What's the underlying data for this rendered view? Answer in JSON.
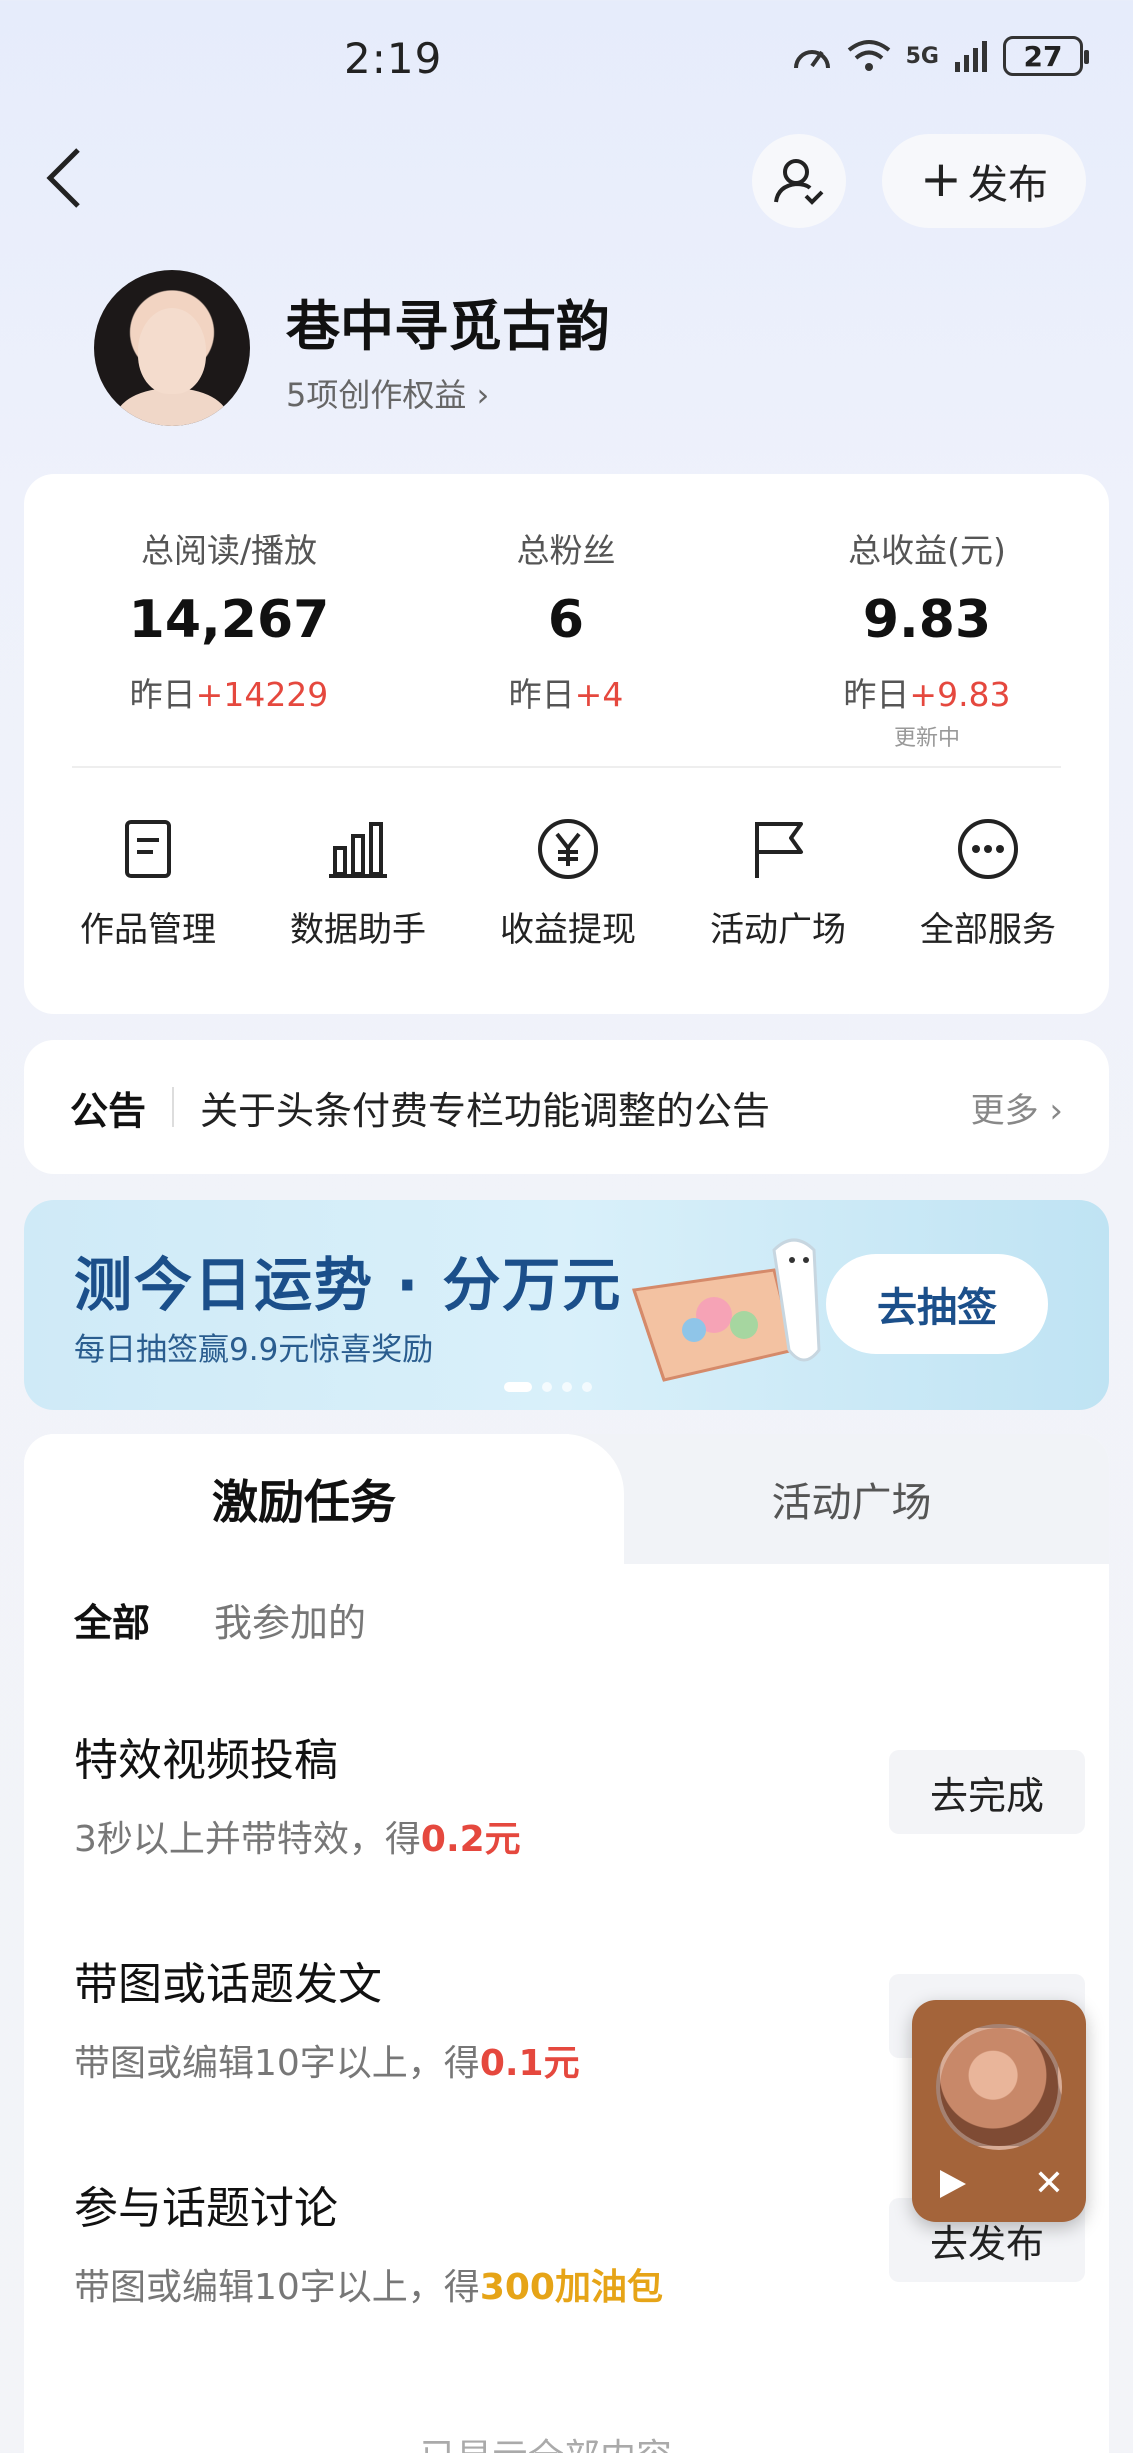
{
  "status_bar": {
    "time": "2:19",
    "network": "5G",
    "battery": "27"
  },
  "header": {
    "publish_label": "发布"
  },
  "profile": {
    "name": "巷中寻觅古韵",
    "rights_link": "5项创作权益 ›"
  },
  "stats": [
    {
      "label": "总阅读/播放",
      "value": "14,267",
      "delta_prefix": "昨日",
      "delta": "+14229",
      "note": ""
    },
    {
      "label": "总粉丝",
      "value": "6",
      "delta_prefix": "昨日",
      "delta": "+4",
      "note": ""
    },
    {
      "label": "总收益(元)",
      "value": "9.83",
      "delta_prefix": "昨日",
      "delta": "+9.83",
      "note": "更新中"
    }
  ],
  "services": [
    {
      "label": "作品管理",
      "icon": "document-icon"
    },
    {
      "label": "数据助手",
      "icon": "bar-chart-icon"
    },
    {
      "label": "收益提现",
      "icon": "yuan-icon"
    },
    {
      "label": "活动广场",
      "icon": "flag-icon"
    },
    {
      "label": "全部服务",
      "icon": "more-icon"
    }
  ],
  "notice": {
    "tag": "公告",
    "text": "关于头条付费专栏功能调整的公告",
    "more": "更多 ›"
  },
  "banner": {
    "title": "测今日运势 · 分万元",
    "subtitle": "每日抽签赢9.9元惊喜奖励",
    "button": "去抽签"
  },
  "tasks": {
    "tabs": [
      "激励任务",
      "活动广场"
    ],
    "filters": [
      "全部",
      "我参加的"
    ],
    "items": [
      {
        "title": "特效视频投稿",
        "desc": "3秒以上并带特效，得",
        "reward": "0.2元",
        "button": "去完成"
      },
      {
        "title": "带图或话题发文",
        "desc": "带图或编辑10字以上，得",
        "reward": "0.1元",
        "button": "去完成"
      },
      {
        "title": "参与话题讨论",
        "desc": "带图或编辑10字以上，得",
        "reward": "300加油包",
        "button": "去发布"
      }
    ],
    "bottom_hint": "已显示全部内容"
  },
  "colors": {
    "accent_red": "#e5483e",
    "accent_orange": "#e6a417",
    "banner_blue": "#1b4f8a"
  }
}
